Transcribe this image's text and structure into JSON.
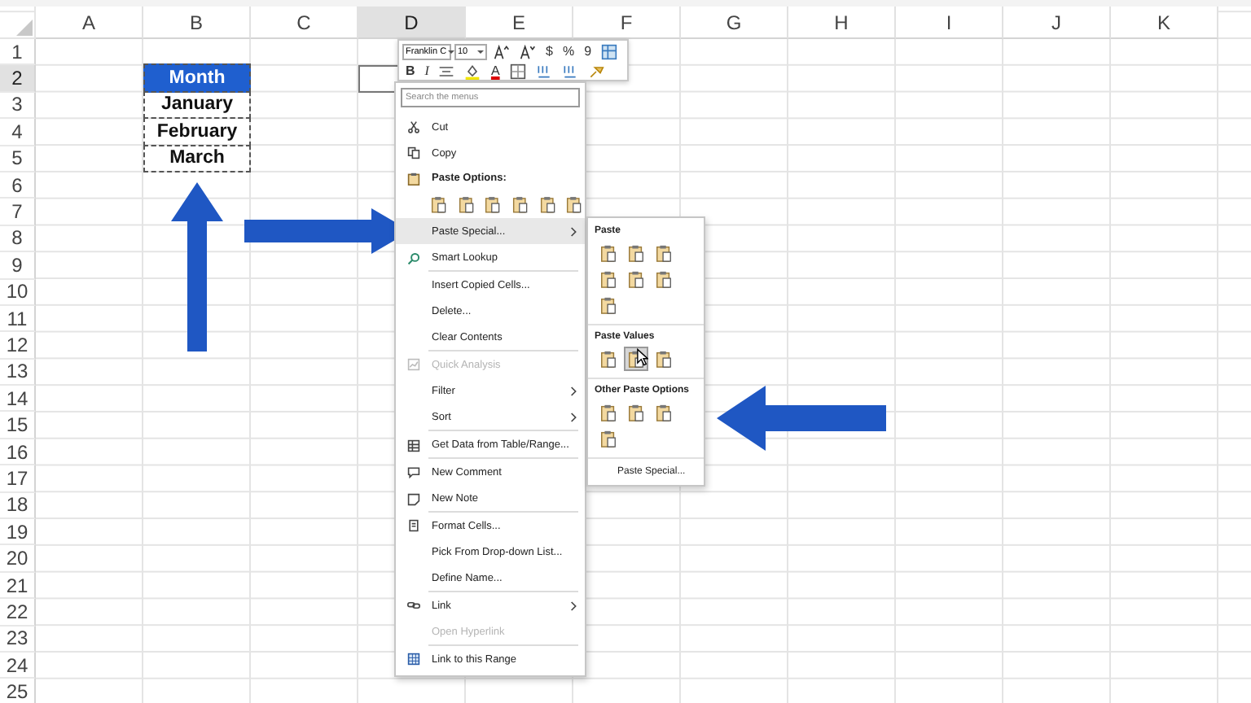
{
  "columns": [
    {
      "label": "A",
      "selected": false
    },
    {
      "label": "B",
      "selected": false
    },
    {
      "label": "C",
      "selected": false
    },
    {
      "label": "D",
      "selected": true
    },
    {
      "label": "E",
      "selected": false
    },
    {
      "label": "F",
      "selected": false
    },
    {
      "label": "G",
      "selected": false
    },
    {
      "label": "H",
      "selected": false
    },
    {
      "label": "I",
      "selected": false
    },
    {
      "label": "J",
      "selected": false
    },
    {
      "label": "K",
      "selected": false
    }
  ],
  "rows": [
    {
      "label": "1",
      "selected": false
    },
    {
      "label": "2",
      "selected": true
    },
    {
      "label": "3",
      "selected": false
    },
    {
      "label": "4",
      "selected": false
    },
    {
      "label": "5",
      "selected": false
    },
    {
      "label": "6",
      "selected": false
    },
    {
      "label": "7",
      "selected": false
    },
    {
      "label": "8",
      "selected": false
    },
    {
      "label": "9",
      "selected": false
    },
    {
      "label": "10",
      "selected": false
    },
    {
      "label": "11",
      "selected": false
    },
    {
      "label": "12",
      "selected": false
    },
    {
      "label": "13",
      "selected": false
    },
    {
      "label": "14",
      "selected": false
    },
    {
      "label": "15",
      "selected": false
    },
    {
      "label": "16",
      "selected": false
    },
    {
      "label": "17",
      "selected": false
    },
    {
      "label": "18",
      "selected": false
    },
    {
      "label": "19",
      "selected": false
    },
    {
      "label": "20",
      "selected": false
    },
    {
      "label": "21",
      "selected": false
    },
    {
      "label": "22",
      "selected": false
    },
    {
      "label": "23",
      "selected": false
    },
    {
      "label": "24",
      "selected": false
    },
    {
      "label": "25",
      "selected": false
    }
  ],
  "data_range": {
    "header": "Month",
    "values": [
      "January",
      "February",
      "March"
    ],
    "copied": true
  },
  "mini_toolbar": {
    "font": "Franklin C",
    "size": "10",
    "row1": [
      {
        "kind": "grow"
      },
      {
        "kind": "shrink"
      },
      {
        "kind": "text",
        "label": "$"
      },
      {
        "kind": "text",
        "label": "%"
      },
      {
        "kind": "text",
        "label": "9"
      },
      {
        "kind": "format"
      }
    ],
    "row2": [
      {
        "kind": "bold",
        "label": "B"
      },
      {
        "kind": "italic",
        "label": "I"
      },
      {
        "kind": "align"
      },
      {
        "kind": "fill"
      },
      {
        "kind": "fontcolor",
        "label": "A"
      },
      {
        "kind": "borders"
      },
      {
        "kind": "decimal"
      },
      {
        "kind": "decimal"
      },
      {
        "kind": "painter"
      }
    ]
  },
  "context_menu": {
    "search_placeholder": "Search the menus",
    "items": [
      {
        "kind": "item",
        "label": "Cut",
        "disabled": false,
        "submenu": false,
        "selected": false,
        "separator": false
      },
      {
        "kind": "item",
        "label": "Copy",
        "disabled": false,
        "submenu": false,
        "selected": false,
        "separator": false
      },
      {
        "kind": "header",
        "label": "Paste Options:"
      },
      {
        "kind": "icons",
        "icons": [
          {
            "selected": false
          },
          {
            "selected": false
          },
          {
            "selected": false
          },
          {
            "selected": false
          },
          {
            "selected": false
          },
          {
            "selected": false
          }
        ]
      },
      {
        "kind": "item",
        "label": "Paste Special...",
        "disabled": false,
        "submenu": true,
        "selected": true,
        "separator": false
      },
      {
        "kind": "item",
        "label": "Smart Lookup",
        "disabled": false,
        "submenu": false,
        "selected": false,
        "separator": true
      },
      {
        "kind": "item",
        "label": "Insert Copied Cells...",
        "disabled": false,
        "submenu": false,
        "selected": false,
        "separator": false
      },
      {
        "kind": "item",
        "label": "Delete...",
        "disabled": false,
        "submenu": false,
        "selected": false,
        "separator": false
      },
      {
        "kind": "item",
        "label": "Clear Contents",
        "disabled": false,
        "submenu": false,
        "selected": false,
        "separator": true
      },
      {
        "kind": "item",
        "label": "Quick Analysis",
        "disabled": true,
        "submenu": false,
        "selected": false,
        "separator": false
      },
      {
        "kind": "item",
        "label": "Filter",
        "disabled": false,
        "submenu": true,
        "selected": false,
        "separator": false
      },
      {
        "kind": "item",
        "label": "Sort",
        "disabled": false,
        "submenu": true,
        "selected": false,
        "separator": true
      },
      {
        "kind": "item",
        "label": "Get Data from Table/Range...",
        "disabled": false,
        "submenu": false,
        "selected": false,
        "separator": true
      },
      {
        "kind": "item",
        "label": "New Comment",
        "disabled": false,
        "submenu": false,
        "selected": false,
        "separator": false
      },
      {
        "kind": "item",
        "label": "New Note",
        "disabled": false,
        "submenu": false,
        "selected": false,
        "separator": true
      },
      {
        "kind": "item",
        "label": "Format Cells...",
        "disabled": false,
        "submenu": false,
        "selected": false,
        "separator": false
      },
      {
        "kind": "item",
        "label": "Pick From Drop-down List...",
        "disabled": false,
        "submenu": false,
        "selected": false,
        "separator": false
      },
      {
        "kind": "item",
        "label": "Define Name...",
        "disabled": false,
        "submenu": false,
        "selected": false,
        "separator": true
      },
      {
        "kind": "item",
        "label": "Link",
        "disabled": false,
        "submenu": true,
        "selected": false,
        "separator": false
      },
      {
        "kind": "item",
        "label": "Open Hyperlink",
        "disabled": true,
        "submenu": false,
        "selected": false,
        "separator": true
      },
      {
        "kind": "item",
        "label": "Link to this Range",
        "disabled": false,
        "submenu": false,
        "selected": false,
        "separator": false
      }
    ]
  },
  "submenu": {
    "groups": [
      {
        "title": "Paste",
        "icons": [
          {
            "selected": false
          },
          {
            "selected": false
          },
          {
            "selected": false
          },
          {
            "selected": false
          },
          {
            "selected": false
          },
          {
            "selected": false
          },
          {
            "selected": false
          }
        ]
      },
      {
        "title": "Paste Values",
        "icons": [
          {
            "selected": false
          },
          {
            "selected": true
          },
          {
            "selected": false
          }
        ]
      },
      {
        "title": "Other Paste Options",
        "icons": [
          {
            "selected": false
          },
          {
            "selected": false
          },
          {
            "selected": false
          },
          {
            "selected": false
          }
        ]
      }
    ],
    "footer": "Paste Special..."
  }
}
